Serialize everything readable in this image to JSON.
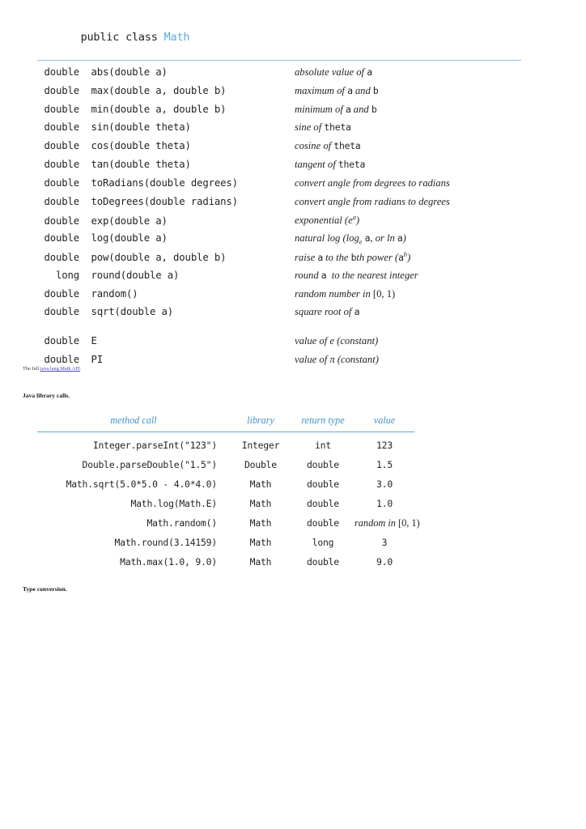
{
  "api": {
    "title_keywords": "public class ",
    "title_class": "Math",
    "rows": [
      {
        "ret": "double",
        "sig": "abs(double a)",
        "desc_html": "absolute value of <span class=\"mono\">a</span>"
      },
      {
        "ret": "double",
        "sig": "max(double a, double b)",
        "desc_html": "maximum of <span class=\"mono\">a</span> and <span class=\"mono\">b</span>"
      },
      {
        "ret": "double",
        "sig": "min(double a, double b)",
        "desc_html": "minimum of <span class=\"mono\">a</span> and <span class=\"mono\">b</span>"
      },
      {
        "ret": "double",
        "sig": "sin(double theta)",
        "desc_html": "sine of <span class=\"mono\">theta</span>"
      },
      {
        "ret": "double",
        "sig": "cos(double theta)",
        "desc_html": "cosine of <span class=\"mono\">theta</span>"
      },
      {
        "ret": "double",
        "sig": "tan(double theta)",
        "desc_html": "tangent of <span class=\"mono\">theta</span>"
      },
      {
        "ret": "double",
        "sig": "toRadians(double degrees)",
        "desc_html": "convert angle from degrees to radians"
      },
      {
        "ret": "double",
        "sig": "toDegrees(double radians)",
        "desc_html": "convert angle from radians to degrees"
      },
      {
        "ret": "double",
        "sig": "exp(double a)",
        "desc_html": "exponential (<i>e</i><sup>a</sup>)"
      },
      {
        "ret": "double",
        "sig": "log(double a)",
        "desc_html": "natural log (log<sub>e</sub> <span class=\"mono\">a</span>, or ln <span class=\"mono\">a</span>)"
      },
      {
        "ret": "double",
        "sig": "pow(double a, double b)",
        "desc_html": "raise <span class=\"mono\">a</span> to the <span class=\"mono\">b</span>th power (<span class=\"mono\">a</span><sup>b</sup>)"
      },
      {
        "ret": "long",
        "sig": "round(double a)",
        "desc_html": "round <span class=\"mono\">a</span>  to the nearest integer"
      },
      {
        "ret": "double",
        "sig": "random()",
        "desc_html": "random number in <span class=\"up\">[0, 1)</span>"
      },
      {
        "ret": "double",
        "sig": "sqrt(double a)",
        "desc_html": "square root of <span class=\"mono\">a</span>"
      },
      {
        "spacer": true
      },
      {
        "ret": "double",
        "sig": "E",
        "desc_html": "value of <i>e</i> <span>(constant)</span>"
      },
      {
        "ret": "double",
        "sig": "PI",
        "desc_html": "value of π (constant)"
      }
    ]
  },
  "link_caption": {
    "prefix": "The full ",
    "link_text": "java.lang.Math API",
    "suffix": "."
  },
  "captions": {
    "java_library": "Java library calls.",
    "type_conversion": "Type conversion."
  },
  "calls": {
    "headers": [
      "method call",
      "library",
      "return type",
      "value"
    ],
    "rows": [
      {
        "call": "Integer.parseInt(\"123\")",
        "library": "Integer",
        "return_type": "int",
        "value": "123",
        "value_italic": false
      },
      {
        "call": "Double.parseDouble(\"1.5\")",
        "library": "Double",
        "return_type": "double",
        "value": "1.5",
        "value_italic": false
      },
      {
        "call": "Math.sqrt(5.0*5.0 - 4.0*4.0)",
        "library": "Math",
        "return_type": "double",
        "value": "3.0",
        "value_italic": false
      },
      {
        "call": "Math.log(Math.E)",
        "library": "Math",
        "return_type": "double",
        "value": "1.0",
        "value_italic": false
      },
      {
        "call": "Math.random()",
        "library": "Math",
        "return_type": "double",
        "value_html": "random in <span class=\"up\">[0, 1)</span>",
        "value_italic": true
      },
      {
        "call": "Math.round(3.14159)",
        "library": "Math",
        "return_type": "long",
        "value": "3",
        "value_italic": false
      },
      {
        "call": "Math.max(1.0, 9.0)",
        "library": "Math",
        "return_type": "double",
        "value": "9.0",
        "value_italic": false
      }
    ]
  },
  "colors": {
    "rule_blue": "#8fc2e0",
    "header_blue": "#3f93c8",
    "class_name_blue": "#5da9d8",
    "link_purple": "#4a4ac0",
    "text": "#231f20"
  }
}
